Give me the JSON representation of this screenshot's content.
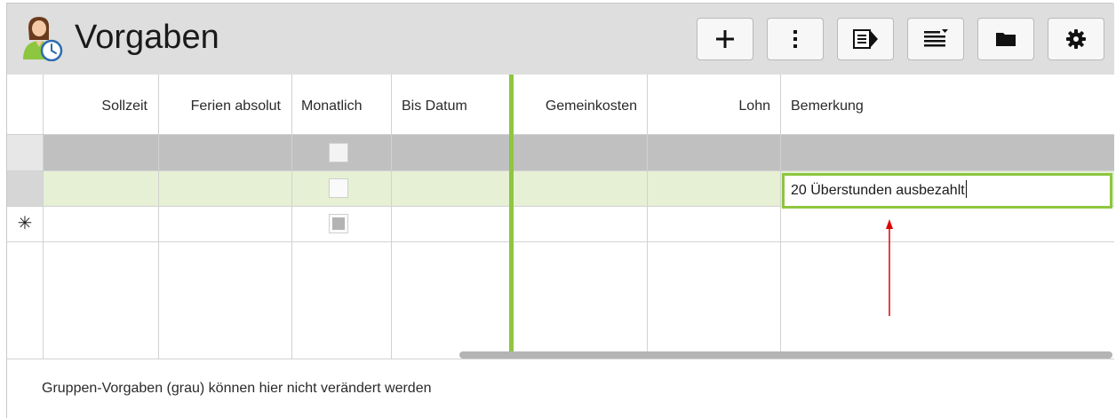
{
  "app": {
    "title": "Vorgaben",
    "title_icon": "user-clock-icon"
  },
  "toolbar": {
    "buttons": [
      {
        "name": "add-button",
        "icon": "plus-icon"
      },
      {
        "name": "more-button",
        "icon": "vertical-dots-icon"
      },
      {
        "name": "detail-panel-button",
        "icon": "document-arrow-icon"
      },
      {
        "name": "filter-list-button",
        "icon": "list-dropdown-icon"
      },
      {
        "name": "folder-button",
        "icon": "folder-icon"
      },
      {
        "name": "settings-button",
        "icon": "gear-icon"
      }
    ]
  },
  "grid": {
    "columns": [
      "Sollzeit",
      "Ferien absolut",
      "Monatlich",
      "Bis Datum",
      "Gemeinkosten",
      "Lohn",
      "Bemerkung"
    ],
    "rows": [
      {
        "type": "group",
        "monatlich": false,
        "bemerkung": ""
      },
      {
        "type": "selected",
        "monatlich": false,
        "bemerkung": "20 Überstunden ausbezahlt"
      },
      {
        "type": "new",
        "marker": "✳",
        "monatlich": null,
        "bemerkung": ""
      }
    ]
  },
  "footer": {
    "note": "Gruppen-Vorgaben (grau) können hier nicht verändert werden"
  },
  "colors": {
    "accent": "#8dc63f",
    "group_row": "#c0c0c0",
    "selected_row": "#e6f0d4",
    "annotation_arrow": "#e00000"
  }
}
